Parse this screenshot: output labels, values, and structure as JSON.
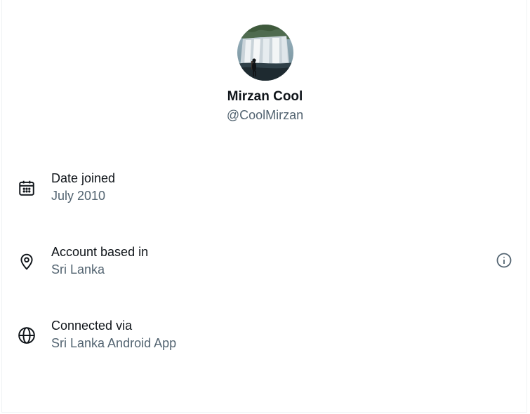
{
  "profile": {
    "display_name": "Mirzan Cool",
    "handle": "@CoolMirzan",
    "avatar_icon": "avatar-waterfall-photo"
  },
  "about": [
    {
      "icon": "calendar-icon",
      "label": "Date joined",
      "value": "July 2010"
    },
    {
      "icon": "location-pin-icon",
      "label": "Account based in",
      "value": "Sri Lanka",
      "info_icon": "info-icon"
    },
    {
      "icon": "globe-icon",
      "label": "Connected via",
      "value": "Sri Lanka Android App"
    }
  ],
  "colors": {
    "text_primary": "#0f1419",
    "text_secondary": "#536471",
    "border": "#eff3f4"
  }
}
